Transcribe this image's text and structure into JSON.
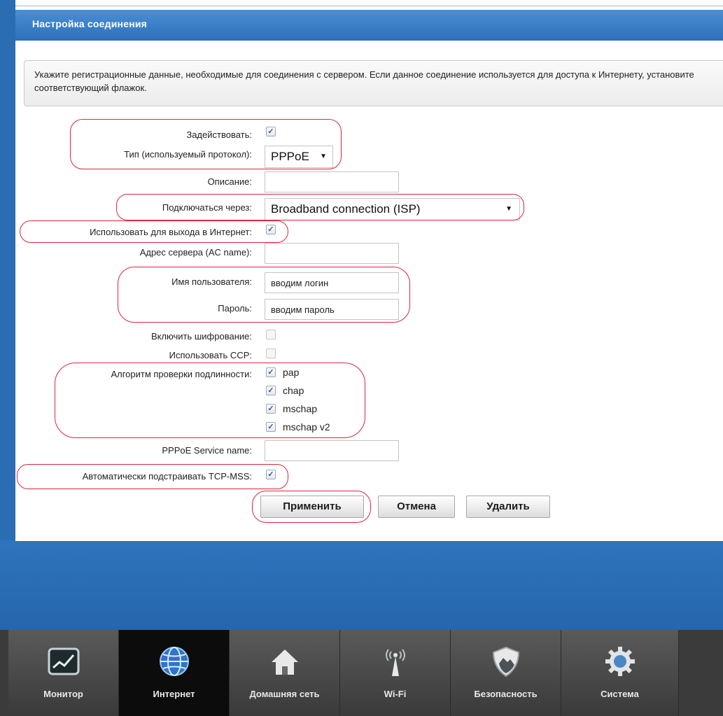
{
  "panel": {
    "title": "Настройка соединения",
    "info_text": "Укажите регистрационные данные, необходимые для соединения с сервером. Если данное соединение используется для доступа к Интернету, установите соответствующий флажок."
  },
  "form": {
    "enable_label": "Задействовать:",
    "enable_checked": true,
    "protocol_label": "Тип (используемый протокол):",
    "protocol_value": "PPPoE",
    "description_label": "Описание:",
    "description_value": "",
    "connect_via_label": "Подключаться через:",
    "connect_via_value": "Broadband connection (ISP)",
    "use_internet_label": "Использовать для выхода в Интернет:",
    "use_internet_checked": true,
    "server_label": "Адрес сервера (AC name):",
    "server_value": "",
    "username_label": "Имя пользователя:",
    "username_value": "вводим логин",
    "password_label": "Пароль:",
    "password_value": "вводим пароль",
    "encryption_label": "Включить шифрование:",
    "encryption_checked": false,
    "ccp_label": "Использовать CCP:",
    "ccp_checked": false,
    "auth_label": "Алгоритм проверки подлинности:",
    "auth_options": [
      {
        "label": "pap",
        "checked": true
      },
      {
        "label": "chap",
        "checked": true
      },
      {
        "label": "mschap",
        "checked": true
      },
      {
        "label": "mschap v2",
        "checked": true
      }
    ],
    "service_name_label": "PPPoE Service name:",
    "service_name_value": "",
    "tcp_mss_label": "Автоматически подстраивать TCP-MSS:",
    "tcp_mss_checked": true
  },
  "buttons": {
    "apply": "Применить",
    "cancel": "Отмена",
    "delete": "Удалить"
  },
  "nav": {
    "active": "Интернет",
    "items": [
      {
        "label": "Монитор",
        "icon": "monitor-chart-icon"
      },
      {
        "label": "Интернет",
        "icon": "globe-icon"
      },
      {
        "label": "Домашняя сеть",
        "icon": "house-icon"
      },
      {
        "label": "Wi-Fi",
        "icon": "wifi-antenna-icon"
      },
      {
        "label": "Безопасность",
        "icon": "shield-icon"
      },
      {
        "label": "Система",
        "icon": "gear-icon"
      }
    ]
  },
  "colors": {
    "accent_blue": "#2d6fb9",
    "highlight_red": "#d9283a",
    "nav_dark": "#3b3b3b"
  }
}
